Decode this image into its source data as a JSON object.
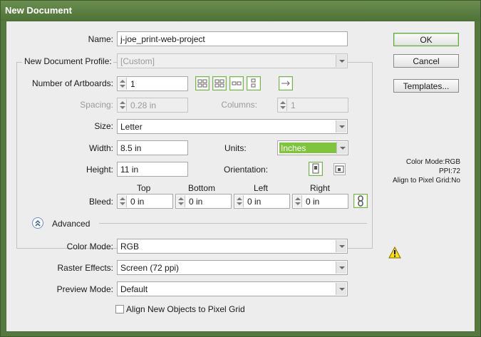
{
  "window": {
    "title": "New Document"
  },
  "name": {
    "label": "Name:",
    "value": "j-joe_print-web-project"
  },
  "profile": {
    "label": "New Document Profile:",
    "value": "[Custom]"
  },
  "artboards": {
    "label": "Number of Artboards:",
    "value": "1",
    "layout_icons": [
      "grid-by-row-icon",
      "grid-by-column-icon",
      "arrange-by-row-icon",
      "arrange-by-column-icon",
      "right-to-left-icon"
    ]
  },
  "spacing": {
    "label": "Spacing:",
    "value": "0.28 in"
  },
  "columns": {
    "label": "Columns:",
    "value": "1"
  },
  "size": {
    "label": "Size:",
    "value": "Letter"
  },
  "width": {
    "label": "Width:",
    "value": "8.5 in"
  },
  "units": {
    "label": "Units:",
    "value": "Inches"
  },
  "height": {
    "label": "Height:",
    "value": "11 in"
  },
  "orientation": {
    "label": "Orientation:",
    "options": [
      "portrait",
      "landscape"
    ],
    "selected": "portrait"
  },
  "bleed": {
    "label": "Bleed:",
    "headers": [
      "Top",
      "Bottom",
      "Left",
      "Right"
    ],
    "values": [
      "0 in",
      "0 in",
      "0 in",
      "0 in"
    ],
    "linked": true
  },
  "advanced": {
    "label": "Advanced",
    "color_mode": {
      "label": "Color Mode:",
      "value": "RGB"
    },
    "raster_effects": {
      "label": "Raster Effects:",
      "value": "Screen (72 ppi)"
    },
    "preview_mode": {
      "label": "Preview Mode:",
      "value": "Default"
    },
    "align_pixel_grid": {
      "label": "Align New Objects to Pixel Grid",
      "checked": false
    }
  },
  "buttons": {
    "ok": "OK",
    "cancel": "Cancel",
    "templates": "Templates..."
  },
  "info": {
    "color_mode": "Color Mode:RGB",
    "ppi": "PPI:72",
    "align": "Align to Pixel Grid:No"
  },
  "colors": {
    "titlebar": "#55783f",
    "units_highlight": "#7ec43c",
    "focus_border": "#76b252"
  }
}
